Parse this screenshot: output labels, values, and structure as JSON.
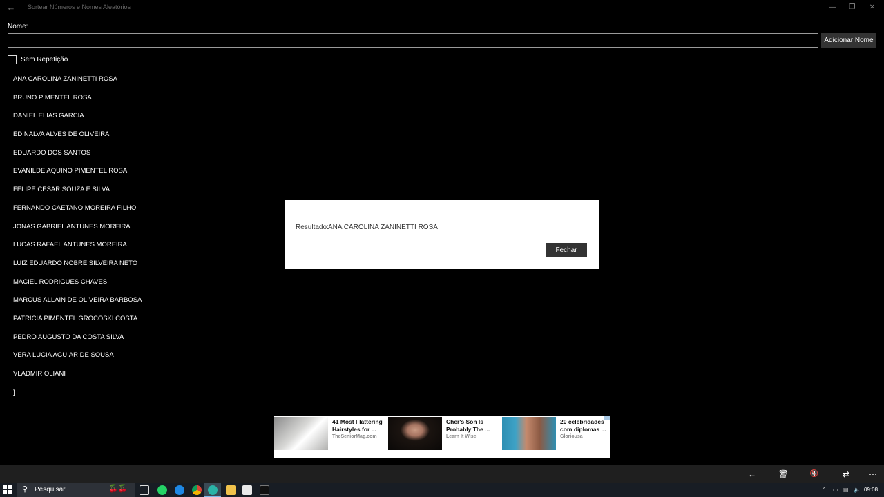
{
  "window": {
    "title": "Sortear Números e Nomes Aleatórios"
  },
  "form": {
    "name_label": "Nome:",
    "name_value": "",
    "add_button_label": "Adicionar Nome",
    "no_repeat_label": "Sem Repetição",
    "no_repeat_checked": false
  },
  "names": [
    "ANA CAROLINA ZANINETTI ROSA",
    "BRUNO PIMENTEL ROSA",
    "DANIEL ELIAS GARCIA",
    "EDINALVA ALVES DE OLIVEIRA",
    "EDUARDO DOS SANTOS",
    "EVANILDE AQUINO PIMENTEL ROSA",
    "FELIPE CESAR SOUZA E SILVA",
    "FERNANDO CAETANO MOREIRA FILHO",
    "JONAS GABRIEL ANTUNES MOREIRA",
    "LUCAS RAFAEL ANTUNES MOREIRA",
    "LUIZ EDUARDO NOBRE SILVEIRA NETO",
    "MACIEL RODRIGUES CHAVES",
    "MARCUS ALLAIN DE OLIVEIRA BARBOSA",
    "PATRICIA PIMENTEL GROCOSKI COSTA",
    "PEDRO AUGUSTO DA COSTA SILVA",
    "VERA LUCIA AGUIAR DE SOUSA",
    "VLADMIR OLIANI",
    "]"
  ],
  "dialog": {
    "result_label": "Resultado:",
    "result_value": "ANA CAROLINA ZANINETTI ROSA",
    "close_button_label": "Fechar"
  },
  "ads": [
    {
      "headline": "41 Most Flattering Hairstyles for ...",
      "source": "TheSeniorMag.com"
    },
    {
      "headline": "Cher's Son Is Probably The ...",
      "source": "Learn It Wise"
    },
    {
      "headline": "20 celebridades com diplomas ...",
      "source": "Gloriousa"
    }
  ],
  "command_bar": {
    "icons": [
      "back-arrow-icon",
      "delete-icon",
      "mute-icon",
      "shuffle-icon",
      "more-icon"
    ]
  },
  "taskbar": {
    "search_placeholder": "Pesquisar",
    "clock": "09:08"
  }
}
